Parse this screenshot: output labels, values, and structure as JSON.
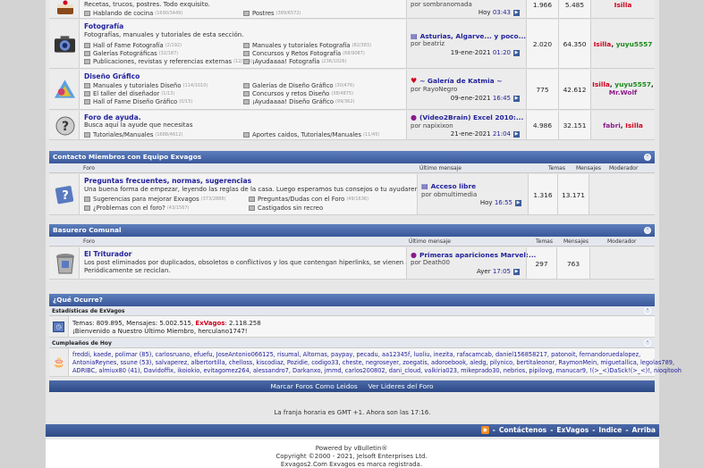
{
  "forums": [
    {
      "icon": "cake-icon",
      "description": "Recetas, trucos, postres. Todo exquisito.",
      "subforums": [
        {
          "name": "Hablando de cocina",
          "count": "(1690/3449)"
        },
        {
          "name": "Postres",
          "count": "(389/6572)"
        }
      ],
      "last_by": "por sombranomada",
      "last_date": "Hoy",
      "last_time": "03:43",
      "threads": "1.966",
      "posts": "5.485",
      "moderators": [
        "Isilla"
      ]
    },
    {
      "icon": "camera-icon",
      "title": "Fotografía",
      "description": "Fotografías, manuales y tutoriales de esta sección.",
      "subforums": [
        {
          "name": "Hall of Fame Fotografía",
          "count": "(2/192)"
        },
        {
          "name": "Manuales y tutoriales Fotografía",
          "count": "(82/383)"
        },
        {
          "name": "Galerías Fotográficas",
          "count": "(32/187)"
        },
        {
          "name": "Concursos y Retos Fotografía",
          "count": "(68/9087)"
        },
        {
          "name": "Publicaciones, revistas y referencias externas",
          "count": "(12/185)"
        },
        {
          "name": "¡Ayudaaaa! Fotografía",
          "count": "(236/1026)"
        }
      ],
      "last_title": "Asturias, Algarve... y poco...",
      "last_by": "por beatriz",
      "last_date": "19-ene-2021",
      "last_time": "01:20",
      "threads": "2.020",
      "posts": "64.350",
      "moderators": [
        "Isilla",
        "yuyu5557"
      ]
    },
    {
      "icon": "palette-icon",
      "title": "Diseño Gráfico",
      "subforums": [
        {
          "name": "Manuales y tutoriales Diseño",
          "count": "(114/1010)"
        },
        {
          "name": "Galerías de Diseño Gráfico",
          "count": "(30/476)"
        },
        {
          "name": "El taller del diseñador",
          "count": "(1/13)"
        },
        {
          "name": "Concursos y retos Diseño",
          "count": "(38/4875)"
        },
        {
          "name": "Hall of Fame Diseño Gráfico",
          "count": "(0/15)"
        },
        {
          "name": "¡Ayudaaaa! Diseño Gráfico",
          "count": "(99/362)"
        }
      ],
      "last_title": "~ Galería de Katmia ~",
      "last_by": "por RayoNegro",
      "last_date": "09-ene-2021",
      "last_time": "16:45",
      "threads": "775",
      "posts": "42.612",
      "moderators": [
        "Isilla",
        "yuyu5557",
        "Mr.Wolf"
      ]
    },
    {
      "icon": "question-icon",
      "title": "Foro de ayuda.",
      "description": "Busca aquí la ayude que necesitas",
      "subforums": [
        {
          "name": "Tutoriales/Manuales",
          "count": "(1688/4612)"
        },
        {
          "name": "Aportes caidos, Tutoriales/Manuales",
          "count": "(11/45)"
        }
      ],
      "last_title": "(Video2Brain) Excel 2010:...",
      "last_by": "por napixixon",
      "last_date": "21-ene-2021",
      "last_time": "21:04",
      "threads": "4.986",
      "posts": "32.151",
      "moderators": [
        "fabri",
        "Isilla"
      ]
    }
  ],
  "categories": {
    "contacto": {
      "title": "Contacto Miembros con Equipo Exvagos",
      "columns": {
        "forum": "Foro",
        "last": "Último mensaje",
        "threads": "Temas",
        "posts": "Mensajes",
        "mod": "Moderador"
      },
      "forum": {
        "title": "Preguntas frecuentes, normas, sugerencias",
        "description": "Una buena forma de empezar, leyendo las reglas de la casa. Luego esperamos tus consejos o tu ayudaremos.",
        "subforums": [
          {
            "name": "Sugerencias para mejorar Exvagos",
            "count": "(373/2888)"
          },
          {
            "name": "Preguntas/Dudas con el Foro",
            "count": "(49/1636)"
          },
          {
            "name": "¿Problemas con el foro?",
            "count": "(43/1567)"
          },
          {
            "name": "Castigados sin recreo",
            "count": ""
          }
        ],
        "last_title": "Acceso libre",
        "last_by": "por obmultimedia",
        "last_date": "Hoy",
        "last_time": "16:55",
        "threads": "1.316",
        "posts": "13.171"
      }
    },
    "basurero": {
      "title": "Basurero Comunal",
      "columns": {
        "forum": "Foro",
        "last": "Último mensaje",
        "threads": "Temas",
        "posts": "Mensajes",
        "mod": "Moderador"
      },
      "forum": {
        "title": "El Triturador",
        "description": "Los post eliminados por duplicados, obsoletos o conflictivos y los que contengan hiperlinks, se vienen aquí.",
        "description2": "Periódicamente se reciclan.",
        "last_title": "Primeras apariciones Marvel:...",
        "last_by": "por Death00",
        "last_date": "Ayer",
        "last_time": "17:05",
        "threads": "297",
        "posts": "763"
      }
    }
  },
  "whats_on": {
    "title": "¿Qué Ocurre?",
    "stats_header": "Estadísticas de ExVagos",
    "stats_line": "Temas: 809.895, Mensajes: 5.002.515,",
    "users_label": "ExVagos",
    "users_value": ": 2.118.258",
    "welcome_line": "¡Bienvenido a Nuestro Último Miembro, herculano1747!",
    "birthday_header": "Cumpleaños de Hoy",
    "birthday_line1": "freddi, kaede, polimar (85), carlosruano, efuefu, JoseAntonio066125, risumal, Altornas, paypay, pecadu, aa12345f, luoliu, inezita, rafacamcab, daniel156858217, patonoit, fernandoruedalopez,",
    "birthday_line2": "AntoniaReynes, ssune (53), salvaperez, albertortilla, chelloss, kiscodiaz, Pozidie, codigo33, cheste, negroseyer, zoegatis, adoroebook, aledg, pilynico, bertitaleonor, RaymonMein, miguetallica, legolas789,",
    "birthday_line3": "ADRIBC, almiux80 (41), Davidoffix, ikoiokio, evitagomez264, alessandro7, Darkanxo, jmmd, carlos200802, dani_cloud, valkiria023, mikeprado30, nebrios, pipilovg, manucar9, !(>_<)DaSck!(>_<)!, nioqitooh"
  },
  "linkbar": {
    "mark_read": "Marcar Foros Como Leidos",
    "leaders": "Ver Lideres del Foro"
  },
  "timezone": "La franja horaria es GMT +1. Ahora son las 17:16.",
  "navbar": {
    "contact": "Contáctenos",
    "home": "ExVagos",
    "index": "Indice",
    "top": "Arriba",
    "sep": "-"
  },
  "footer": {
    "powered": "Powered by vBulletin®",
    "copyright": "Copyright ©2000 - 2021, Jelsoft Enterprises Ltd.",
    "trademark": "Exvagos2.Com Exvagos es marca registrada."
  },
  "colors": {
    "nav_blue": "#39579a",
    "red": "#d0001c",
    "green": "#1a8a1a",
    "purple": "#8a1a8a"
  }
}
